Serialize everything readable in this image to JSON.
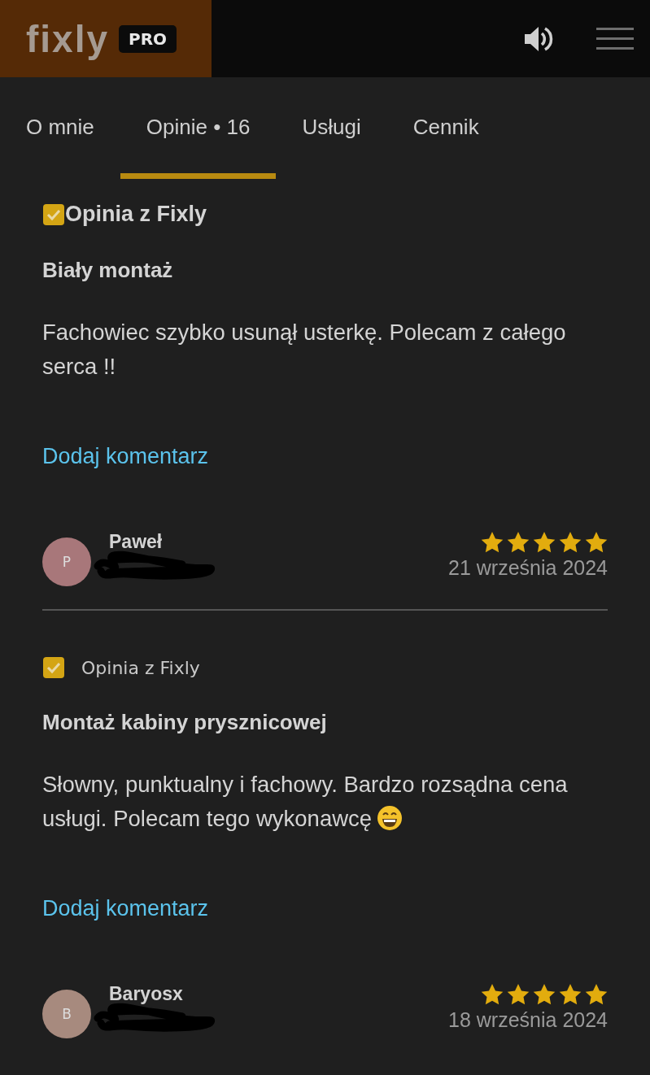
{
  "header": {
    "logo": "fixly",
    "badge": "PRO"
  },
  "tabs": [
    {
      "label": "O mnie",
      "selected": false
    },
    {
      "label": "Opinie • 16",
      "selected": true
    },
    {
      "label": "Usługi",
      "selected": false
    },
    {
      "label": "Cennik",
      "selected": false
    }
  ],
  "reviews": [
    {
      "verified": true,
      "verified_label": "Opinia z Fixly",
      "verified_bold": true,
      "title": "Biały montaż",
      "body": "Fachowiec szybko usunął usterkę. Polecam z całego serca !!",
      "comment_link": "Dodaj komentarz",
      "author": "Paweł",
      "initial": "P",
      "color": "#a8777a",
      "redacted": true,
      "stars": 5,
      "date": "21 września 2024",
      "divider": true
    },
    {
      "verified": true,
      "verified_label": "Opinia z Fixly",
      "verified_bold": false,
      "title": "Montaż kabiny prysznicowej",
      "body": "Słowny, punktualny i fachowy. Bardzo rozsądna cena usługi. Polecam tego wykonawcę",
      "emoji": true,
      "comment_link": "Dodaj komentarz",
      "author": "Baryosx",
      "initial": "B",
      "color": "#a78a7e",
      "redacted": true,
      "stars": 5,
      "date": "18 września 2024"
    }
  ]
}
